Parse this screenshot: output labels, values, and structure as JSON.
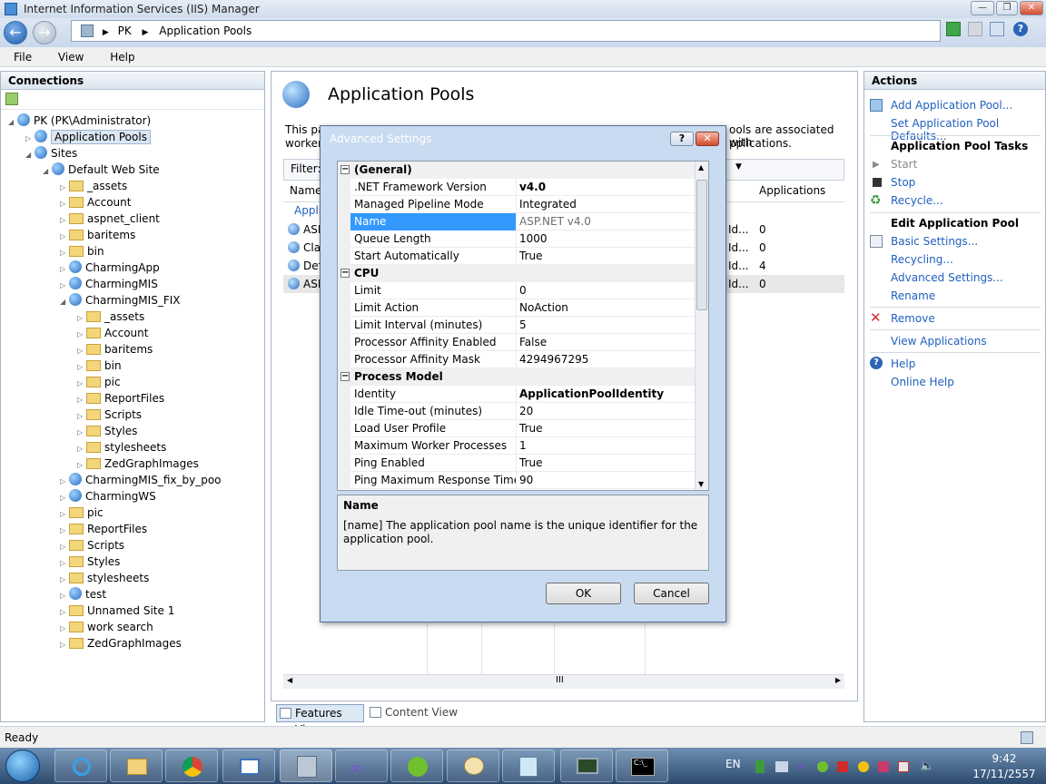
{
  "window": {
    "title": "Internet Information Services (IIS) Manager"
  },
  "address": {
    "segments": [
      "PK",
      "Application Pools"
    ]
  },
  "menu": [
    "File",
    "View",
    "Help"
  ],
  "connections": {
    "title": "Connections",
    "tree": [
      {
        "label": "PK (PK\\Administrator)",
        "level": 0,
        "icon": "server-icon"
      },
      {
        "label": "Application Pools",
        "level": 1,
        "icon": "app-pool-icon",
        "selected": true
      },
      {
        "label": "Sites",
        "level": 1,
        "icon": "sites-icon"
      },
      {
        "label": "Default Web Site",
        "level": 2,
        "icon": "globe-icon"
      },
      {
        "label": "_assets",
        "level": 3,
        "icon": "folder-icon"
      },
      {
        "label": "Account",
        "level": 3,
        "icon": "folder-icon"
      },
      {
        "label": "aspnet_client",
        "level": 3,
        "icon": "folder-icon"
      },
      {
        "label": "baritems",
        "level": 3,
        "icon": "folder-icon"
      },
      {
        "label": "bin",
        "level": 3,
        "icon": "folder-icon"
      },
      {
        "label": "CharmingApp",
        "level": 3,
        "icon": "app-icon"
      },
      {
        "label": "CharmingMIS",
        "level": 3,
        "icon": "app-icon"
      },
      {
        "label": "CharmingMIS_FIX",
        "level": 3,
        "icon": "app-icon"
      },
      {
        "label": "_assets",
        "level": 4,
        "icon": "folder-icon"
      },
      {
        "label": "Account",
        "level": 4,
        "icon": "folder-icon"
      },
      {
        "label": "baritems",
        "level": 4,
        "icon": "folder-icon"
      },
      {
        "label": "bin",
        "level": 4,
        "icon": "folder-icon"
      },
      {
        "label": "pic",
        "level": 4,
        "icon": "folder-icon"
      },
      {
        "label": "ReportFiles",
        "level": 4,
        "icon": "folder-icon"
      },
      {
        "label": "Scripts",
        "level": 4,
        "icon": "folder-icon"
      },
      {
        "label": "Styles",
        "level": 4,
        "icon": "folder-icon"
      },
      {
        "label": "stylesheets",
        "level": 4,
        "icon": "folder-icon"
      },
      {
        "label": "ZedGraphImages",
        "level": 4,
        "icon": "folder-icon"
      },
      {
        "label": "CharmingMIS_fix_by_poo",
        "level": 3,
        "icon": "app-icon"
      },
      {
        "label": "CharmingWS",
        "level": 3,
        "icon": "app-icon"
      },
      {
        "label": "pic",
        "level": 3,
        "icon": "folder-icon"
      },
      {
        "label": "ReportFiles",
        "level": 3,
        "icon": "folder-icon"
      },
      {
        "label": "Scripts",
        "level": 3,
        "icon": "folder-icon"
      },
      {
        "label": "Styles",
        "level": 3,
        "icon": "folder-icon"
      },
      {
        "label": "stylesheets",
        "level": 3,
        "icon": "folder-icon"
      },
      {
        "label": "test",
        "level": 3,
        "icon": "app-icon"
      },
      {
        "label": "Unnamed Site 1",
        "level": 3,
        "icon": "folder-icon"
      },
      {
        "label": "work search",
        "level": 3,
        "icon": "folder-icon"
      },
      {
        "label": "ZedGraphImages",
        "level": 3,
        "icon": "folder-icon"
      }
    ]
  },
  "center": {
    "title": "Application Pools",
    "desc_left": "This pa",
    "desc_left2": "worker",
    "desc_right": "ools are associated with",
    "desc_right2": "pplications.",
    "filter_label": "Filter:",
    "col_name": "Name",
    "col_apps": "Applications",
    "group_label": "Appli",
    "rows": [
      {
        "name": "ASP",
        "id": "Id...",
        "apps": "0"
      },
      {
        "name": "Cla",
        "id": "Id...",
        "apps": "0"
      },
      {
        "name": "Def",
        "id": "Id...",
        "apps": "4"
      },
      {
        "name": "ASP",
        "id": "Id...",
        "apps": "0"
      }
    ],
    "scroll_mid": "III",
    "features_view": "Features View",
    "content_view": "Content View"
  },
  "actions": {
    "title": "Actions",
    "add_pool": "Add Application Pool...",
    "set_defaults": "Set Application Pool Defaults...",
    "tasks_title": "Application Pool Tasks",
    "start": "Start",
    "stop": "Stop",
    "recycle": "Recycle...",
    "edit_title": "Edit Application Pool",
    "basic": "Basic Settings...",
    "recycling": "Recycling...",
    "advanced": "Advanced Settings...",
    "rename": "Rename",
    "remove": "Remove",
    "view_apps": "View Applications",
    "help": "Help",
    "online_help": "Online Help"
  },
  "dialog": {
    "title": "Advanced Settings",
    "help_btn": "?",
    "close_btn": "✕",
    "categories": [
      {
        "name": "(General)",
        "props": [
          {
            "k": ".NET Framework Version",
            "v": "v4.0",
            "bold": true
          },
          {
            "k": "Managed Pipeline Mode",
            "v": "Integrated"
          },
          {
            "k": "Name",
            "v": "ASP.NET v4.0",
            "selected": true
          },
          {
            "k": "Queue Length",
            "v": "1000"
          },
          {
            "k": "Start Automatically",
            "v": "True"
          }
        ]
      },
      {
        "name": "CPU",
        "props": [
          {
            "k": "Limit",
            "v": "0"
          },
          {
            "k": "Limit Action",
            "v": "NoAction"
          },
          {
            "k": "Limit Interval (minutes)",
            "v": "5"
          },
          {
            "k": "Processor Affinity Enabled",
            "v": "False"
          },
          {
            "k": "Processor Affinity Mask",
            "v": "4294967295"
          }
        ]
      },
      {
        "name": "Process Model",
        "props": [
          {
            "k": "Identity",
            "v": "ApplicationPoolIdentity",
            "bold": true
          },
          {
            "k": "Idle Time-out (minutes)",
            "v": "20"
          },
          {
            "k": "Load User Profile",
            "v": "True"
          },
          {
            "k": "Maximum Worker Processes",
            "v": "1"
          },
          {
            "k": "Ping Enabled",
            "v": "True"
          },
          {
            "k": "Ping Maximum Response Time (s",
            "v": "90"
          }
        ]
      }
    ],
    "desc_title": "Name",
    "desc_text": "[name] The application pool name is the unique identifier for the application pool.",
    "ok": "OK",
    "cancel": "Cancel"
  },
  "status": {
    "text": "Ready"
  },
  "taskbar": {
    "lang": "EN",
    "time": "9:42",
    "date": "17/11/2557"
  }
}
